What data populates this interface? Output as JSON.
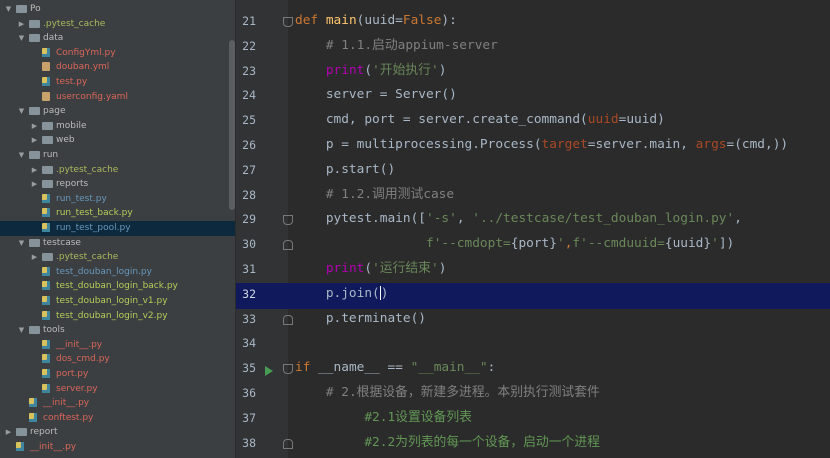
{
  "project_tree": {
    "rows": [
      {
        "indent": 0,
        "arrow": "▼",
        "icon": "folder",
        "label": "Po",
        "color": "plain",
        "selected": false
      },
      {
        "indent": 1,
        "arrow": "▶",
        "icon": "folder",
        "label": ".pytest_cache",
        "color": "ign",
        "selected": false
      },
      {
        "indent": 1,
        "arrow": "▼",
        "icon": "folder",
        "label": "data",
        "color": "plain",
        "selected": false
      },
      {
        "indent": 2,
        "arrow": "",
        "icon": "py",
        "label": "ConfigYml.py",
        "color": "red",
        "selected": false
      },
      {
        "indent": 2,
        "arrow": "",
        "icon": "yml",
        "label": "douban.yml",
        "color": "red",
        "selected": false
      },
      {
        "indent": 2,
        "arrow": "",
        "icon": "py",
        "label": "test.py",
        "color": "red",
        "selected": false
      },
      {
        "indent": 2,
        "arrow": "",
        "icon": "yml",
        "label": "userconfig.yaml",
        "color": "red",
        "selected": false
      },
      {
        "indent": 1,
        "arrow": "▼",
        "icon": "folder",
        "label": "page",
        "color": "plain",
        "selected": false
      },
      {
        "indent": 2,
        "arrow": "▶",
        "icon": "folder",
        "label": "mobile",
        "color": "plain",
        "selected": false
      },
      {
        "indent": 2,
        "arrow": "▶",
        "icon": "folder",
        "label": "web",
        "color": "plain",
        "selected": false
      },
      {
        "indent": 1,
        "arrow": "▼",
        "icon": "folder",
        "label": "run",
        "color": "plain",
        "selected": false
      },
      {
        "indent": 2,
        "arrow": "▶",
        "icon": "folder",
        "label": ".pytest_cache",
        "color": "ign",
        "selected": false
      },
      {
        "indent": 2,
        "arrow": "▶",
        "icon": "folder",
        "label": "reports",
        "color": "plain",
        "selected": false
      },
      {
        "indent": 2,
        "arrow": "",
        "icon": "py",
        "label": "run_test.py",
        "color": "mod",
        "selected": false
      },
      {
        "indent": 2,
        "arrow": "",
        "icon": "py",
        "label": "run_test_back.py",
        "color": "new",
        "selected": false
      },
      {
        "indent": 2,
        "arrow": "",
        "icon": "py",
        "label": "run_test_pool.py",
        "color": "mod",
        "selected": true
      },
      {
        "indent": 1,
        "arrow": "▼",
        "icon": "folder",
        "label": "testcase",
        "color": "plain",
        "selected": false
      },
      {
        "indent": 2,
        "arrow": "▶",
        "icon": "folder",
        "label": ".pytest_cache",
        "color": "ign",
        "selected": false
      },
      {
        "indent": 2,
        "arrow": "",
        "icon": "py",
        "label": "test_douban_login.py",
        "color": "mod",
        "selected": false
      },
      {
        "indent": 2,
        "arrow": "",
        "icon": "py",
        "label": "test_douban_login_back.py",
        "color": "new",
        "selected": false
      },
      {
        "indent": 2,
        "arrow": "",
        "icon": "py",
        "label": "test_douban_login_v1.py",
        "color": "new",
        "selected": false
      },
      {
        "indent": 2,
        "arrow": "",
        "icon": "py",
        "label": "test_douban_login_v2.py",
        "color": "new",
        "selected": false
      },
      {
        "indent": 1,
        "arrow": "▼",
        "icon": "folder",
        "label": "tools",
        "color": "plain",
        "selected": false
      },
      {
        "indent": 2,
        "arrow": "",
        "icon": "py",
        "label": "__init__.py",
        "color": "red",
        "selected": false
      },
      {
        "indent": 2,
        "arrow": "",
        "icon": "py",
        "label": "dos_cmd.py",
        "color": "red",
        "selected": false
      },
      {
        "indent": 2,
        "arrow": "",
        "icon": "py",
        "label": "port.py",
        "color": "red",
        "selected": false
      },
      {
        "indent": 2,
        "arrow": "",
        "icon": "py",
        "label": "server.py",
        "color": "red",
        "selected": false
      },
      {
        "indent": 1,
        "arrow": "",
        "icon": "py",
        "label": "__init__.py",
        "color": "red",
        "selected": false
      },
      {
        "indent": 1,
        "arrow": "",
        "icon": "py",
        "label": "conftest.py",
        "color": "red",
        "selected": false
      },
      {
        "indent": 0,
        "arrow": "▶",
        "icon": "folder",
        "label": "report",
        "color": "plain",
        "selected": false
      },
      {
        "indent": 0,
        "arrow": "",
        "icon": "py",
        "label": "__init__.py",
        "color": "red",
        "selected": false
      }
    ]
  },
  "editor": {
    "current_line": "32",
    "lines": [
      {
        "num": "21",
        "fold": "top",
        "tokens": [
          [
            "kw",
            "def "
          ],
          [
            "fn",
            "main"
          ],
          [
            "p",
            "(uuid="
          ],
          [
            "kw",
            "False"
          ],
          [
            "p",
            "):"
          ]
        ]
      },
      {
        "num": "22",
        "fold": "",
        "tokens": [
          [
            "p",
            "    "
          ],
          [
            "cm",
            "# 1.1.启动appium-server"
          ]
        ]
      },
      {
        "num": "23",
        "fold": "",
        "tokens": [
          [
            "p",
            "    "
          ],
          [
            "df",
            "print"
          ],
          [
            "p",
            "("
          ],
          [
            "st",
            "'开始执行'"
          ],
          [
            "p",
            ")"
          ]
        ]
      },
      {
        "num": "24",
        "fold": "",
        "tokens": [
          [
            "p",
            "    server = Server()"
          ]
        ]
      },
      {
        "num": "25",
        "fold": "",
        "tokens": [
          [
            "p",
            "    cmd, port = server.create_command("
          ],
          [
            "pa",
            "uuid"
          ],
          [
            "p",
            "=uuid)"
          ]
        ]
      },
      {
        "num": "26",
        "fold": "",
        "tokens": [
          [
            "p",
            "    p = multiprocessing.Process("
          ],
          [
            "pa",
            "target"
          ],
          [
            "p",
            "=server.main, "
          ],
          [
            "pa",
            "args"
          ],
          [
            "p",
            "=(cmd,))"
          ]
        ]
      },
      {
        "num": "27",
        "fold": "",
        "tokens": [
          [
            "p",
            "    p.start()"
          ]
        ]
      },
      {
        "num": "28",
        "fold": "",
        "tokens": [
          [
            "p",
            "    "
          ],
          [
            "cm",
            "# 1.2.调用测试case"
          ]
        ]
      },
      {
        "num": "29",
        "fold": "top",
        "tokens": [
          [
            "p",
            "    pytest.main(["
          ],
          [
            "st",
            "'-s'"
          ],
          [
            "p",
            ", "
          ],
          [
            "st",
            "'../testcase/test_douban_login.py'"
          ],
          [
            "p",
            ","
          ]
        ]
      },
      {
        "num": "30",
        "fold": "bot",
        "tokens": [
          [
            "p",
            "                 "
          ],
          [
            "st",
            "f'--cmdopt="
          ],
          [
            "p",
            "{port}"
          ],
          [
            "st",
            "'"
          ],
          [
            "kw",
            ","
          ],
          [
            "st",
            "f'--cmduuid="
          ],
          [
            "p",
            "{uuid}"
          ],
          [
            "st",
            "'"
          ],
          [
            "p",
            "])"
          ]
        ]
      },
      {
        "num": "31",
        "fold": "",
        "tokens": [
          [
            "p",
            "    "
          ],
          [
            "df",
            "print"
          ],
          [
            "p",
            "("
          ],
          [
            "st",
            "'运行结束'"
          ],
          [
            "p",
            ")"
          ]
        ]
      },
      {
        "num": "32",
        "fold": "",
        "tokens": [
          [
            "p",
            "    p.join("
          ],
          [
            "caret",
            ""
          ],
          [
            "p",
            ")"
          ]
        ]
      },
      {
        "num": "33",
        "fold": "bot",
        "tokens": [
          [
            "p",
            "    p.terminate()"
          ]
        ]
      },
      {
        "num": "34",
        "fold": "",
        "tokens": []
      },
      {
        "num": "35",
        "fold": "top",
        "tokens": [
          [
            "kw",
            "if "
          ],
          [
            "p",
            "__name__ == "
          ],
          [
            "st",
            "\"__main__\""
          ],
          [
            "p",
            ":"
          ]
        ]
      },
      {
        "num": "36",
        "fold": "",
        "tokens": [
          [
            "p",
            "    "
          ],
          [
            "cm",
            "# 2.根据设备，新建多进程。本别执行测试套件"
          ]
        ]
      },
      {
        "num": "37",
        "fold": "",
        "tokens": [
          [
            "p",
            "         "
          ],
          [
            "cm2",
            "#2.1设置设备列表"
          ]
        ]
      },
      {
        "num": "38",
        "fold": "bot",
        "tokens": [
          [
            "p",
            "         "
          ],
          [
            "cm2",
            "#2.2为列表的每一个设备，启动一个进程"
          ]
        ]
      }
    ]
  }
}
